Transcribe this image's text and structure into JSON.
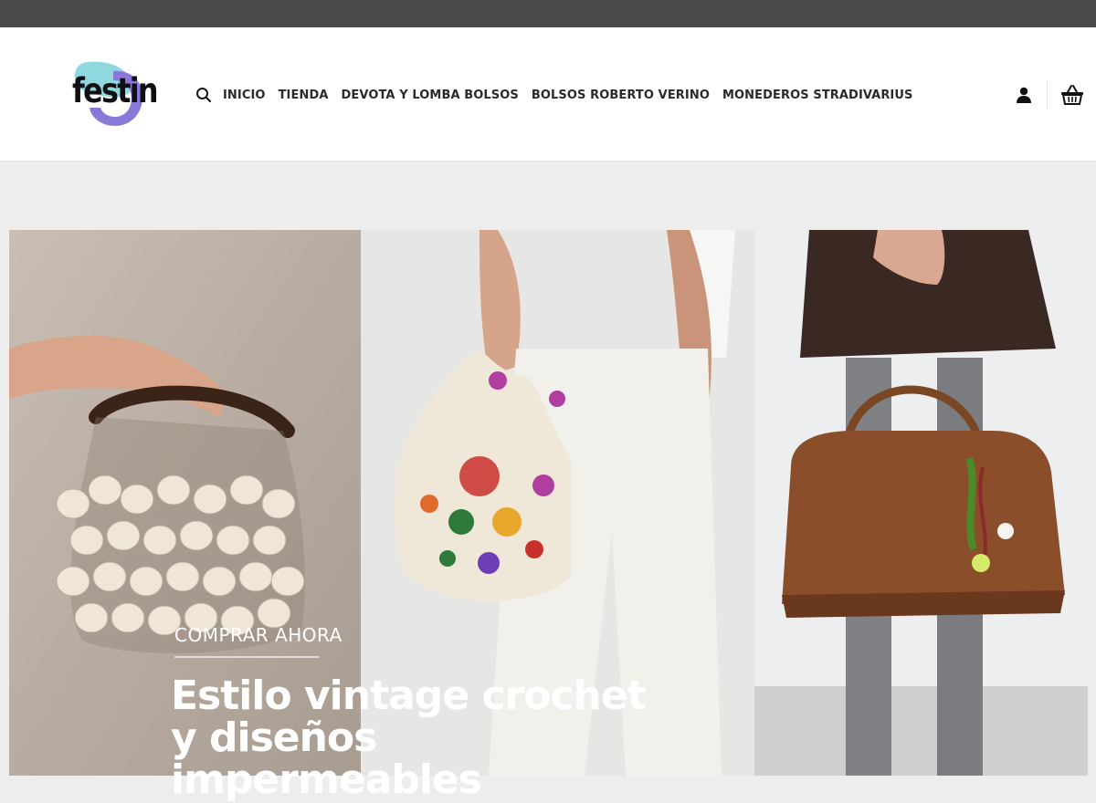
{
  "brand": {
    "logo_text": "festin"
  },
  "nav": {
    "items": [
      {
        "label": "INICIO"
      },
      {
        "label": "TIENDA"
      },
      {
        "label": "DEVOTA Y LOMBA BOLSOS"
      },
      {
        "label": "BOLSOS ROBERTO VERINO"
      },
      {
        "label": "MONEDEROS STRADIVARIUS"
      }
    ]
  },
  "icons": {
    "search": "search-icon",
    "account": "user-icon",
    "cart": "basket-icon"
  },
  "hero": {
    "cta_label": "COMPRAR AHORA",
    "headline": "Estilo vintage crochet y diseños impermeables"
  },
  "colors": {
    "topbar": "#4a4a4c",
    "logo_teal": "#8fd8de",
    "logo_purple": "#8a78d8",
    "nav_text": "#2a2a2a"
  }
}
